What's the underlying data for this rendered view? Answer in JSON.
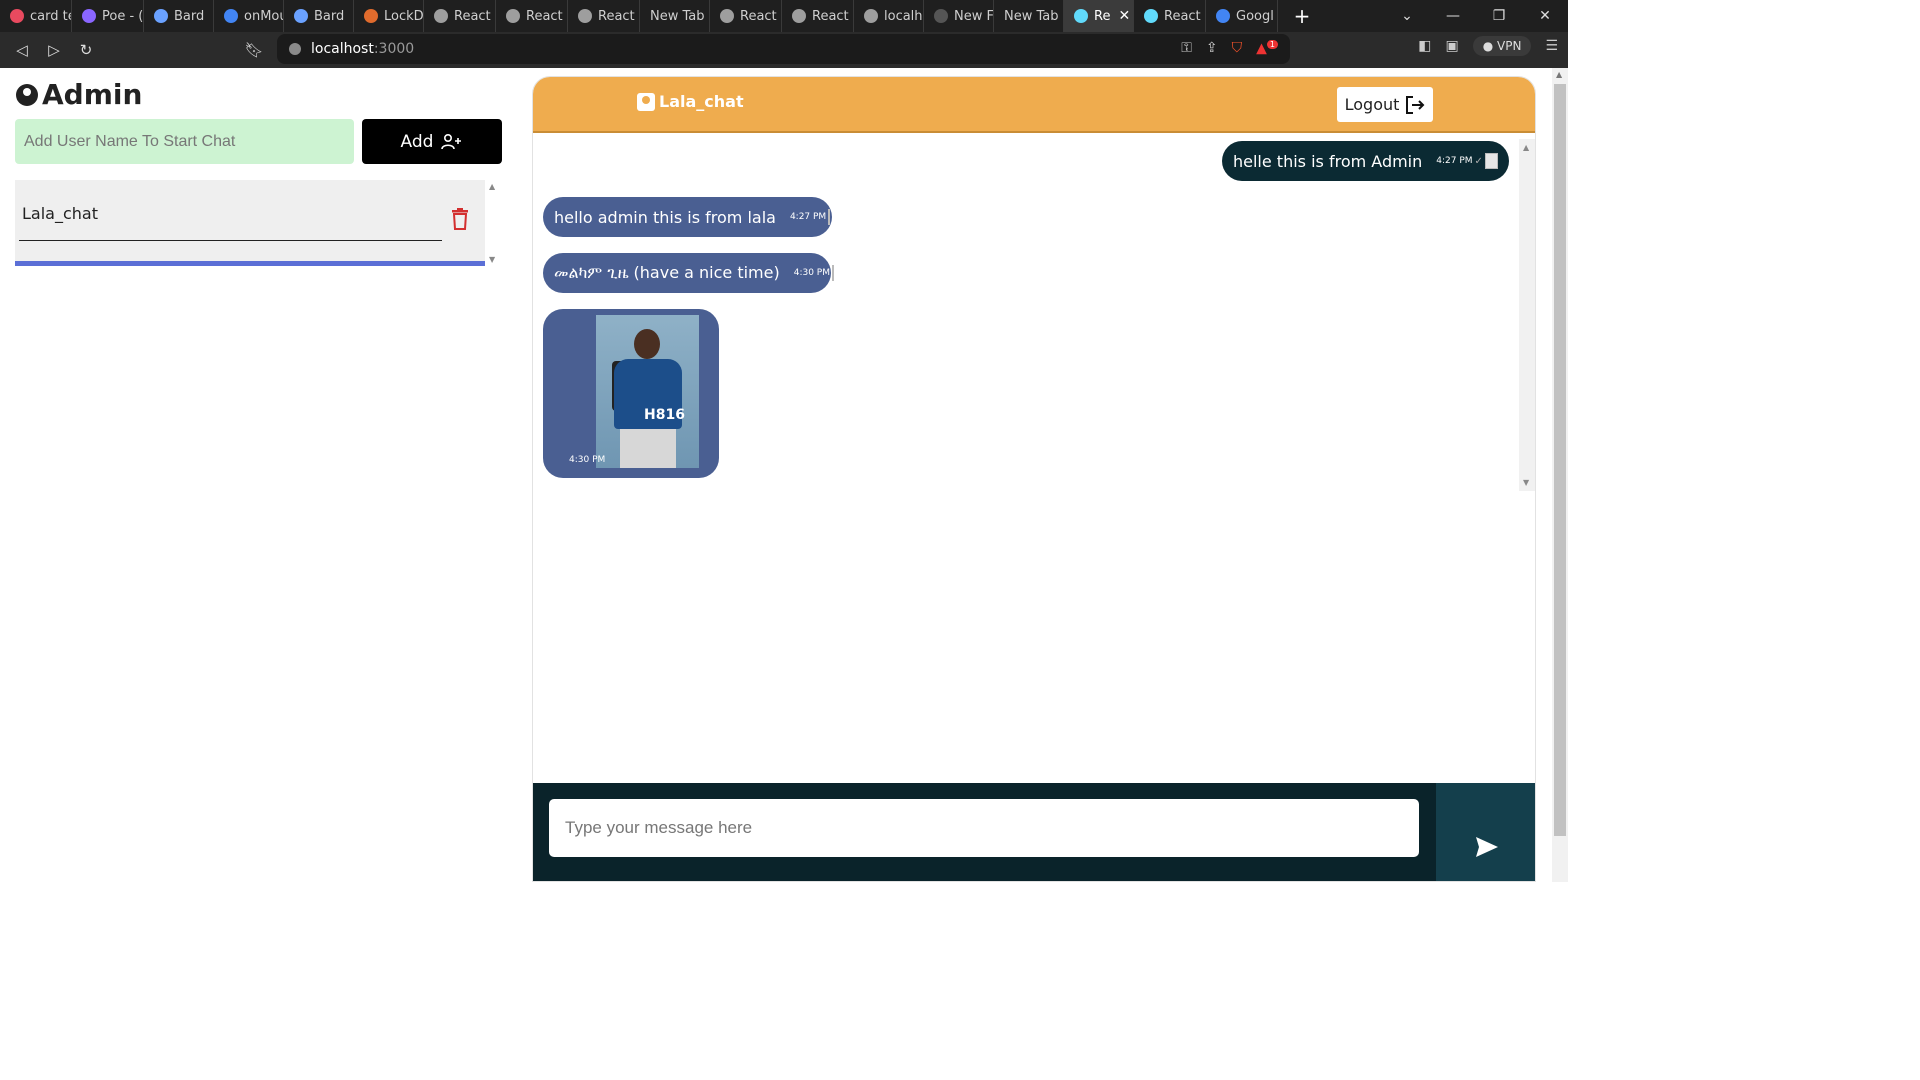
{
  "browser": {
    "tabs": [
      {
        "label": "card te",
        "color": "#e84a5f"
      },
      {
        "label": "Poe - (",
        "color": "#8a66ff"
      },
      {
        "label": "Bard",
        "color": "#6aa1ff"
      },
      {
        "label": "onMou",
        "color": "#4285f4"
      },
      {
        "label": "Bard",
        "color": "#6aa1ff"
      },
      {
        "label": "LockD",
        "color": "#e06b2d"
      },
      {
        "label": "React",
        "color": "#9e9e9e"
      },
      {
        "label": "React",
        "color": "#9e9e9e"
      },
      {
        "label": "React",
        "color": "#9e9e9e"
      },
      {
        "label": "New Tab",
        "color": ""
      },
      {
        "label": "React",
        "color": "#9e9e9e"
      },
      {
        "label": "React",
        "color": "#9e9e9e"
      },
      {
        "label": "localh",
        "color": "#9e9e9e"
      },
      {
        "label": "New F",
        "color": "#555555"
      },
      {
        "label": "New Tab",
        "color": ""
      },
      {
        "label": "Re",
        "color": "#61dafb",
        "active": true
      },
      {
        "label": "React",
        "color": "#61dafb"
      },
      {
        "label": "Googl",
        "color": "#4285f4"
      }
    ],
    "url_host": "localhost",
    "url_port": ":3000",
    "vpn_label": "VPN",
    "notif_count": "1"
  },
  "sidebar": {
    "title": "Admin",
    "add_placeholder": "Add User Name To Start Chat",
    "add_label": "Add",
    "users": [
      {
        "name": "Lala_chat"
      }
    ]
  },
  "chat": {
    "title": "Lala_chat",
    "logout_label": "Logout",
    "messages": [
      {
        "text": "helle this is from Admin",
        "time": "4:27 PM"
      },
      {
        "text": "hello admin this is from lala",
        "time": "4:27 PM"
      },
      {
        "text": "መልካም ጊዜ (have a nice time)",
        "time": "4:30 PM"
      }
    ],
    "image_message": {
      "time": "4:30 PM",
      "caption": "H816"
    },
    "composer_placeholder": "Type your message here"
  },
  "colors": {
    "header": "#efac4e",
    "outgoing": "#0b2a33",
    "incoming": "#4a5f92",
    "add_input": "#cdf3d2"
  }
}
